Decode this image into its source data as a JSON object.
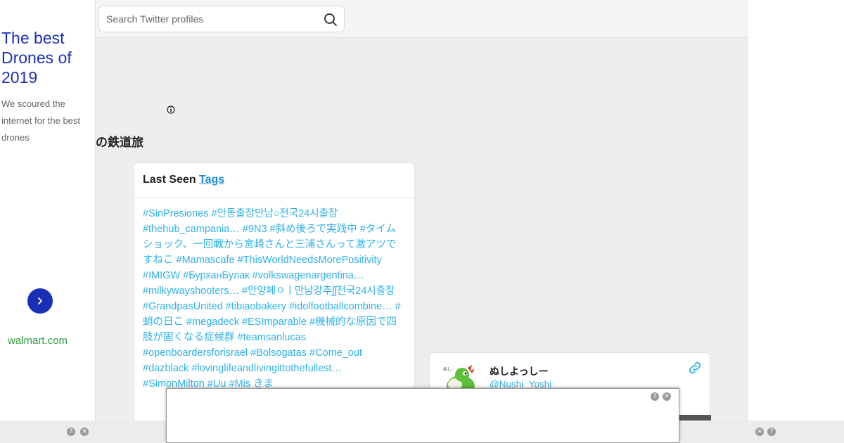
{
  "left_ad": {
    "title": "The best Drones of 2019",
    "description": "We scoured the internet for the best drones",
    "domain": "walmart.com",
    "next_icon": "chevron-right-icon",
    "accent_color": "#1a2fb8"
  },
  "search": {
    "placeholder": "Search Twitter profiles",
    "icon": "search-icon"
  },
  "heading_fragment": "の鉄道旅",
  "last_seen": {
    "title_prefix": "Last Seen",
    "title_link": "Tags",
    "tags": [
      "#SinPresiones",
      "#안동출장만남○전국24시출장",
      "#thehub_campania…",
      "#9N3",
      "#斜め後ろで実践中",
      "#タイムショック、一回戦から宮崎さんと三浦さんって激アツですねこ",
      "#Mamascafe",
      "#ThisWorldNeedsMorePositivity",
      "#IMIGW",
      "#БурханБулак",
      "#volkswagenargentina…",
      "#milkywayshooters…",
      "#안양페ㅇㅣ만남강추ʃʃ전국24시출장",
      "#GrandpasUnited",
      "#tibiaobakery",
      "#idolfootballcombine…",
      "#蛸の日こ",
      "#megadeck",
      "#ESImparable",
      "#機械的な原因で四肢が固くなる症候群",
      "#teamsanlucas",
      "#openboardersforisrael",
      "#Bolsogatas",
      "#Come_out",
      "#dazblack",
      "#lovinglifeandlivingittothefullest…",
      "#SimonMilton",
      "#Uu",
      "#Mis",
      "きま"
    ],
    "tag_color": "#2fb1e8"
  },
  "profile": {
    "display_name": "ぬしよっしー",
    "handle": "@Nushi_Yoshi",
    "link_icon": "link-icon"
  },
  "ad_controls": {
    "help": "?",
    "close": "✕"
  }
}
